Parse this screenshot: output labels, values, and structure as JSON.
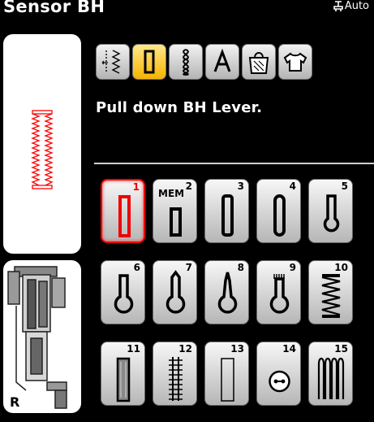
{
  "header": {
    "title": "Sensor BH",
    "auto_label": "Auto"
  },
  "categories": [
    {
      "name": "practical-stitches",
      "selected": false
    },
    {
      "name": "buttonholes",
      "selected": true
    },
    {
      "name": "decorative-stitches",
      "selected": false
    },
    {
      "name": "alphabets",
      "selected": false
    },
    {
      "name": "quilt-stitches",
      "selected": false
    },
    {
      "name": "personal-program",
      "selected": false
    }
  ],
  "message": "Pull down BH Lever.",
  "stitches": [
    {
      "number": "1",
      "selected": true
    },
    {
      "number": "2",
      "mem_label": "MEM"
    },
    {
      "number": "3"
    },
    {
      "number": "4"
    },
    {
      "number": "5"
    },
    {
      "number": "6"
    },
    {
      "number": "7"
    },
    {
      "number": "8"
    },
    {
      "number": "9"
    },
    {
      "number": "10"
    },
    {
      "number": "11"
    },
    {
      "number": "12"
    },
    {
      "number": "13"
    },
    {
      "number": "14"
    },
    {
      "number": "15"
    }
  ],
  "foot": {
    "label": "R"
  },
  "colors": {
    "accent": "#f5b400",
    "selection": "#e00000",
    "preview_stitch": "#ff0000"
  }
}
